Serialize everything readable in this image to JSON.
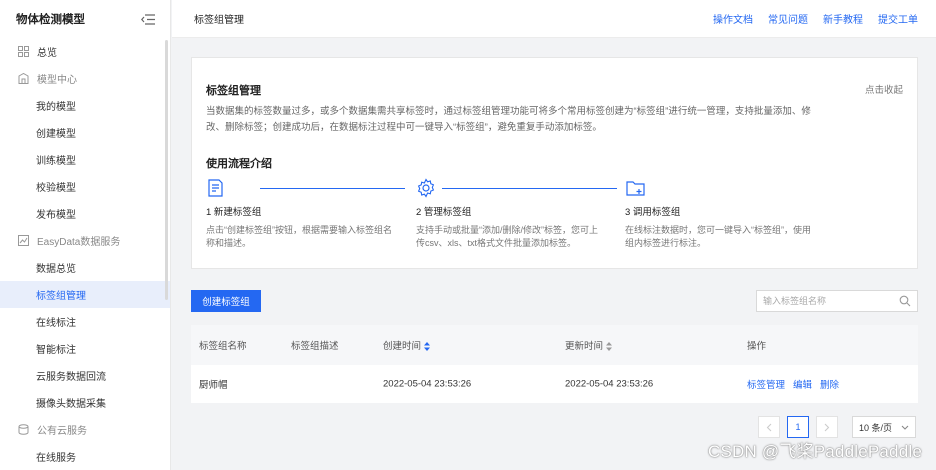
{
  "sidebar": {
    "title": "物体检测模型",
    "items": [
      {
        "label": "总览",
        "kind": "top",
        "icon": "grid-icon"
      },
      {
        "label": "模型中心",
        "kind": "group",
        "icon": "building-icon"
      },
      {
        "label": "我的模型",
        "kind": "sub"
      },
      {
        "label": "创建模型",
        "kind": "sub"
      },
      {
        "label": "训练模型",
        "kind": "sub"
      },
      {
        "label": "校验模型",
        "kind": "sub"
      },
      {
        "label": "发布模型",
        "kind": "sub"
      },
      {
        "label": "EasyData数据服务",
        "kind": "group",
        "icon": "chart-icon"
      },
      {
        "label": "数据总览",
        "kind": "sub"
      },
      {
        "label": "标签组管理",
        "kind": "sub",
        "active": true
      },
      {
        "label": "在线标注",
        "kind": "sub"
      },
      {
        "label": "智能标注",
        "kind": "sub"
      },
      {
        "label": "云服务数据回流",
        "kind": "sub"
      },
      {
        "label": "摄像头数据采集",
        "kind": "sub"
      },
      {
        "label": "公有云服务",
        "kind": "group",
        "icon": "database-icon"
      },
      {
        "label": "在线服务",
        "kind": "sub"
      }
    ]
  },
  "header": {
    "title": "标签组管理",
    "links": [
      "操作文档",
      "常见问题",
      "新手教程",
      "提交工单"
    ]
  },
  "intro": {
    "title": "标签组管理",
    "collapse": "点击收起",
    "desc": "当数据集的标签数量过多，或多个数据集需共享标签时，通过标签组管理功能可将多个常用标签创建为“标签组”进行统一管理，支持批量添加、修改、删除标签；创建成功后，在数据标注过程中可一键导入“标签组”，避免重复手动添加标签。",
    "flow_title": "使用流程介绍",
    "steps": [
      {
        "name": "1 新建标签组",
        "desc": "点击“创建标签组”按钮，根据需要输入标签组名称和描述。",
        "icon": "document-edit-icon"
      },
      {
        "name": "2 管理标签组",
        "desc": "支持手动或批量“添加/删除/修改”标签，您可上传csv、xls、txt格式文件批量添加标签。",
        "icon": "gear-icon"
      },
      {
        "name": "3 调用标签组",
        "desc": "在线标注数据时，您可一键导入“标签组”，使用组内标签进行标注。",
        "icon": "folder-add-icon"
      }
    ],
    "accent": "#2468f2"
  },
  "toolbar": {
    "create_label": "创建标签组",
    "search_placeholder": "输入标签组名称"
  },
  "table": {
    "columns": [
      "标签组名称",
      "标签组描述",
      "创建时间",
      "更新时间",
      "操作"
    ],
    "rows": [
      {
        "name": "厨师帽",
        "desc": "",
        "created": "2022-05-04 23:53:26",
        "updated": "2022-05-04 23:53:26",
        "actions": [
          "标签管理",
          "编辑",
          "删除"
        ]
      }
    ]
  },
  "pagination": {
    "current": "1",
    "page_size": "10 条/页"
  },
  "watermark": "CSDN @飞桨PaddlePaddle"
}
